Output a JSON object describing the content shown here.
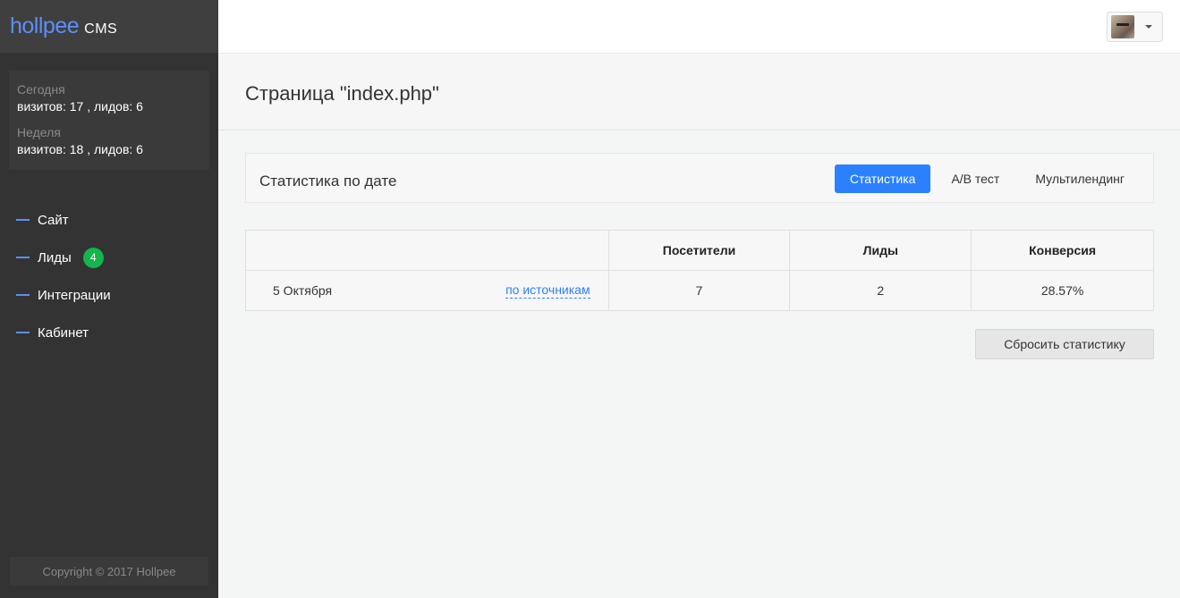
{
  "sidebar": {
    "logo": {
      "brand": "hollpee",
      "suffix": "CMS"
    },
    "stats": {
      "today_label": "Сегодня",
      "today_value": "визитов: 17 , лидов: 6",
      "week_label": "Неделя",
      "week_value": "визитов: 18 , лидов: 6"
    },
    "items": [
      {
        "label": "Сайт"
      },
      {
        "label": "Лиды",
        "badge": "4"
      },
      {
        "label": "Интеграции"
      },
      {
        "label": "Кабинет"
      }
    ],
    "copyright": "Copyright © 2017 Hollpee"
  },
  "topbar": {
    "user_menu_icon": "avatar",
    "caret_icon": "chevron-down-icon"
  },
  "header": {
    "title": "Страница \"index.php\""
  },
  "panel": {
    "title": "Статистика по дате",
    "tabs": [
      {
        "label": "Статистика",
        "active": true
      },
      {
        "label": "A/B тест",
        "active": false
      },
      {
        "label": "Мультилендинг",
        "active": false
      }
    ]
  },
  "table": {
    "columns": [
      "",
      "Посетители",
      "Лиды",
      "Конверсия"
    ],
    "rows": [
      {
        "date": "5 Октября",
        "link": "по источникам",
        "visitors": "7",
        "leads": "2",
        "conversion": "28.57%"
      }
    ]
  },
  "actions": {
    "reset_label": "Сбросить статистику"
  },
  "colors": {
    "accent": "#2b80ff",
    "sidebar_bg": "#333333",
    "badge": "#13b54c"
  }
}
